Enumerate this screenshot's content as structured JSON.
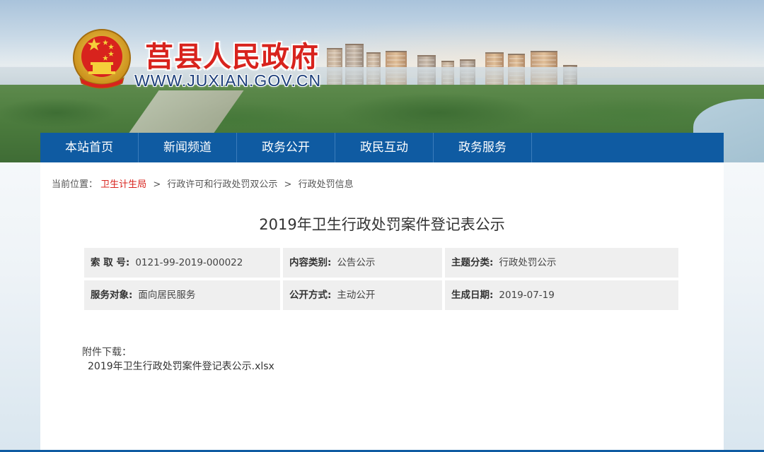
{
  "header": {
    "site_title": "莒县人民政府",
    "site_url": "WWW.JUXIAN.GOV.CN"
  },
  "nav": {
    "items": [
      {
        "label": "本站首页"
      },
      {
        "label": "新闻频道"
      },
      {
        "label": "政务公开"
      },
      {
        "label": "政民互动"
      },
      {
        "label": "政务服务"
      }
    ]
  },
  "breadcrumb": {
    "prefix": "当前位置：",
    "items": [
      {
        "label": "卫生计生局"
      },
      {
        "label": "行政许可和行政处罚双公示"
      },
      {
        "label": "行政处罚信息"
      }
    ],
    "separator": ">"
  },
  "article": {
    "title": "2019年卫生行政处罚案件登记表公示",
    "meta": {
      "index_label": "索 取 号:",
      "index_value": "0121-99-2019-000022",
      "category_label": "内容类别:",
      "category_value": "公告公示",
      "topic_label": "主题分类:",
      "topic_value": "行政处罚公示",
      "audience_label": "服务对象:",
      "audience_value": "面向居民服务",
      "method_label": "公开方式:",
      "method_value": "主动公开",
      "date_label": "生成日期:",
      "date_value": "2019-07-19"
    },
    "attachment_label": "附件下载：",
    "attachment_file": "2019年卫生行政处罚案件登记表公示.xlsx"
  },
  "colors": {
    "nav_blue": "#0f5ba2",
    "title_red": "#d8231d",
    "url_blue": "#1d3f7a",
    "meta_bg": "#efefef"
  }
}
